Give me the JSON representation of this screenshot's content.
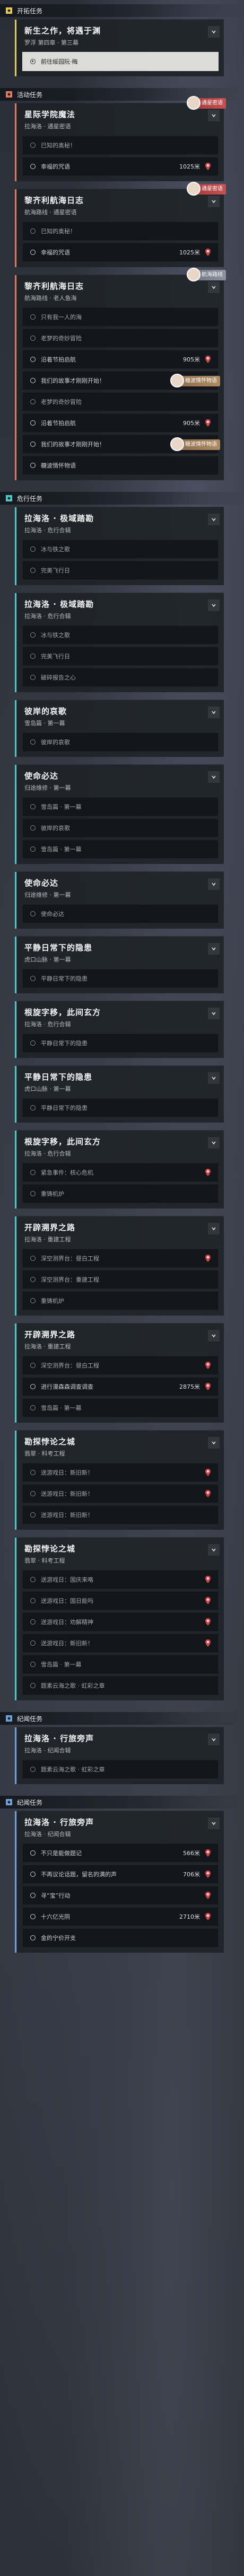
{
  "sections": [
    {
      "name": "开拓任务",
      "color": "#e6c95a",
      "quests": [
        {
          "title": "新生之作，将遇于渊",
          "sub": "罗浮 第四章 · 第三幕",
          "open": true,
          "steps": [
            {
              "text": "前往绥园阮·梅",
              "state": "active"
            }
          ]
        }
      ]
    },
    {
      "name": "活动任务",
      "color": "#e07a5f",
      "quests": [
        {
          "title": "星际学院魔法",
          "sub": "拉海洛 · 通星密语",
          "open": true,
          "badge": {
            "text": "通星密语",
            "kind": "red"
          },
          "steps": [
            {
              "text": "已知的奥秘！",
              "state": "done"
            },
            {
              "text": "幸福的咒语",
              "state": "todo",
              "dist": "1025米"
            }
          ]
        },
        {
          "title": "黎齐利航海日志",
          "sub": "航海路线 · 通星密语",
          "open": true,
          "badge": {
            "text": "通星密语",
            "kind": "red"
          },
          "steps": [
            {
              "text": "已知的奥秘！",
              "state": "done"
            },
            {
              "text": "幸福的咒语",
              "state": "todo",
              "dist": "1025米"
            }
          ]
        },
        {
          "title": "黎齐利航海日志",
          "sub": "航海路线 · 老人鱼海",
          "open": true,
          "badge": {
            "text": "航海路线",
            "kind": "grey"
          },
          "steps": [
            {
              "text": "只有我一人的海",
              "state": "done"
            },
            {
              "text": "老梦的奇妙冒险",
              "state": "done"
            },
            {
              "text": "沿着节拍启航",
              "state": "todo",
              "dist": "905米"
            },
            {
              "text": "我们的故事才刚刚开始！",
              "state": "todo",
              "badge": {
                "text": "糖波情怀物语",
                "kind": "warm"
              }
            },
            {
              "text": "老梦的奇妙冒险",
              "state": "done"
            },
            {
              "text": "沿着节拍启航",
              "state": "todo",
              "dist": "905米"
            },
            {
              "text": "我们的故事才刚刚开始！",
              "state": "todo",
              "badge": {
                "text": "糖波情怀物语",
                "kind": "warm"
              }
            },
            {
              "text": "糖波情怀物语",
              "state": "todo"
            }
          ]
        }
      ]
    },
    {
      "name": "危行任务",
      "color": "#4fc7c7",
      "quests": [
        {
          "title": "拉海洛 · 极域踏勘",
          "sub": "拉海洛 · 危行合辑",
          "open": true,
          "steps": [
            {
              "text": "冰与铁之歌",
              "state": "done"
            },
            {
              "text": "完美飞行日",
              "state": "done"
            }
          ]
        },
        {
          "title": "拉海洛 · 极域踏勘",
          "sub": "拉海洛 · 危行合辑",
          "open": true,
          "steps": [
            {
              "text": "冰与铁之歌",
              "state": "done"
            },
            {
              "text": "完美飞行日",
              "state": "done"
            },
            {
              "text": "破碎报告之心",
              "state": "done"
            }
          ]
        },
        {
          "title": "彼岸的哀歌",
          "sub": "雪岛篇 · 第一幕",
          "open": true,
          "steps": [
            {
              "text": "彼岸的哀歌",
              "state": "done"
            }
          ]
        },
        {
          "title": "使命必达",
          "sub": "归途维修 · 第一幕",
          "open": true,
          "steps": [
            {
              "text": "雪岛篇 · 第一幕",
              "state": "done"
            },
            {
              "text": "彼岸的哀歌",
              "state": "done"
            },
            {
              "text": "雪岛篇 · 第一幕",
              "state": "done"
            }
          ]
        },
        {
          "title": "使命必达",
          "sub": "归途维修 · 第一幕",
          "open": true,
          "steps": [
            {
              "text": "使命必达",
              "state": "done"
            }
          ]
        },
        {
          "title": "平静日常下的隐患",
          "sub": "虎口山脉 · 第一幕",
          "open": true,
          "steps": [
            {
              "text": "平静日常下的隐患",
              "state": "done"
            }
          ]
        },
        {
          "title": "根旋字移，此间玄方",
          "sub": "拉海洛 · 危行合辑",
          "open": true,
          "steps": [
            {
              "text": "平静日常下的隐患",
              "state": "done"
            }
          ]
        },
        {
          "title": "平静日常下的隐患",
          "sub": "虎口山脉 · 第一幕",
          "open": true,
          "steps": [
            {
              "text": "平静日常下的隐患",
              "state": "done"
            }
          ]
        },
        {
          "title": "根旋字移，此间玄方",
          "sub": "拉海洛 · 危行合辑",
          "open": true,
          "steps": [
            {
              "text": "紧急事件：核心危机",
              "state": "done",
              "pin": true
            },
            {
              "text": "重铸机炉",
              "state": "done"
            }
          ]
        },
        {
          "title": "开辟溯界之路",
          "sub": "拉海洛 · 重建工程",
          "open": true,
          "steps": [
            {
              "text": "深空测界台：昼白工程",
              "state": "done",
              "pin": true
            },
            {
              "text": "深空测界台：重建工程",
              "state": "done"
            },
            {
              "text": "重铸机炉",
              "state": "done"
            }
          ]
        },
        {
          "title": "开辟溯界之路",
          "sub": "拉海洛 · 重建工程",
          "open": true,
          "steps": [
            {
              "text": "深空测界台：昼白工程",
              "state": "done",
              "pin": true
            },
            {
              "text": "进行漫森森调查调查",
              "state": "todo",
              "dist": "2875米"
            },
            {
              "text": "雪岛篇 · 第一幕",
              "state": "done"
            }
          ]
        },
        {
          "title": "勘探悖论之城",
          "sub": "翡翠 · 科考工程",
          "open": true,
          "steps": [
            {
              "text": "送游戏日：新旧新！",
              "state": "done",
              "pin": true
            },
            {
              "text": "送游戏日：新旧新！",
              "state": "done",
              "pin": true
            },
            {
              "text": "送游戏日：新旧新！",
              "state": "done"
            }
          ]
        },
        {
          "title": "勘探悖论之城",
          "sub": "翡翠 · 科考工程",
          "open": true,
          "steps": [
            {
              "text": "送游戏日：国庆来咯",
              "state": "done",
              "pin": true
            },
            {
              "text": "送游戏日：国日能吗",
              "state": "done",
              "pin": true
            },
            {
              "text": "送游戏日：劝解精神",
              "state": "done",
              "pin": true
            },
            {
              "text": "送游戏日：新旧新！",
              "state": "done",
              "pin": true
            },
            {
              "text": "雪岛篇 · 第一幕",
              "state": "done"
            },
            {
              "text": "题素云海之歌 · 虹彩之章",
              "state": "done"
            }
          ]
        }
      ]
    },
    {
      "name": "纪闻任务",
      "color": "#6fa0d8",
      "quests": [
        {
          "title": "拉海洛 · 行旅旁声",
          "sub": "拉海洛 · 纪闻合辑",
          "open": true,
          "steps": [
            {
              "text": "题素云海之歌 · 虹彩之章",
              "state": "done"
            }
          ]
        }
      ]
    },
    {
      "name": "纪闻任务",
      "color": "#6fa0d8",
      "quests": [
        {
          "title": "拉海洛 · 行旅旁声",
          "sub": "拉海洛 · 纪闻合辑",
          "open": true,
          "steps": [
            {
              "text": "不只是能做题记",
              "state": "todo",
              "dist": "566米"
            },
            {
              "text": "不再议论话题，留名的满的声",
              "state": "todo",
              "dist": "706米"
            },
            {
              "text": "寻“宝”行动",
              "state": "todo",
              "pin": true
            },
            {
              "text": "十六亿光阴",
              "state": "todo",
              "dist": "2710米"
            },
            {
              "text": "金的宁价开支",
              "state": "todo"
            }
          ]
        }
      ]
    }
  ]
}
